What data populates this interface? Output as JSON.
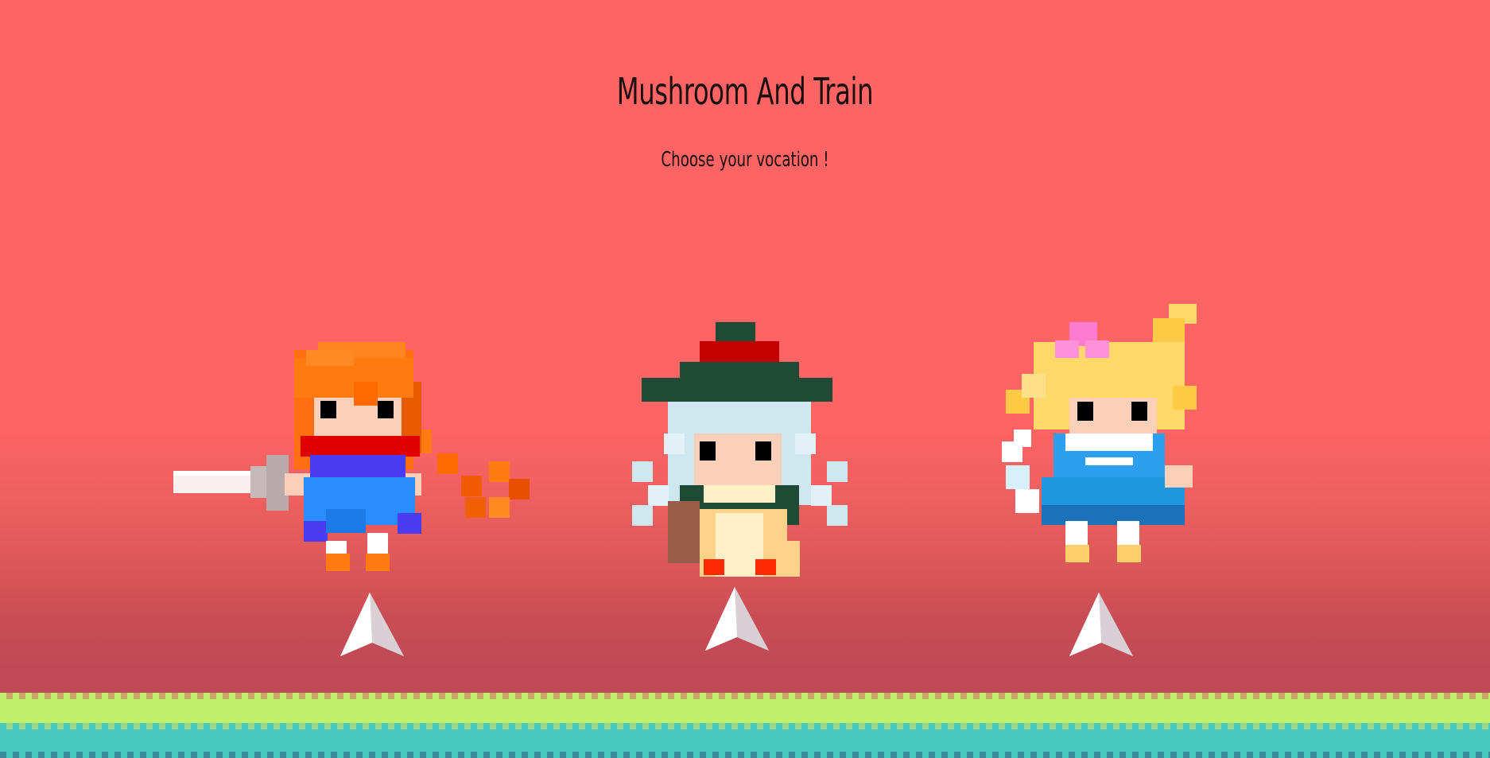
{
  "game": {
    "title": "Mushroom And Train",
    "subtitle": "Choose your vocation !"
  },
  "characters": [
    {
      "id": "warrior",
      "icon": "swordswoman-red-hair-icon",
      "select_icon": "select-arrow-icon"
    },
    {
      "id": "mage",
      "icon": "witch-green-hat-icon",
      "select_icon": "select-arrow-icon"
    },
    {
      "id": "cleric",
      "icon": "blonde-blue-dress-icon",
      "select_icon": "select-arrow-icon"
    }
  ],
  "colors": {
    "background": "#ff6464",
    "ground_grass": "#bff06a",
    "ground_water": "#49c9c0",
    "arrow": "#ffffff"
  }
}
